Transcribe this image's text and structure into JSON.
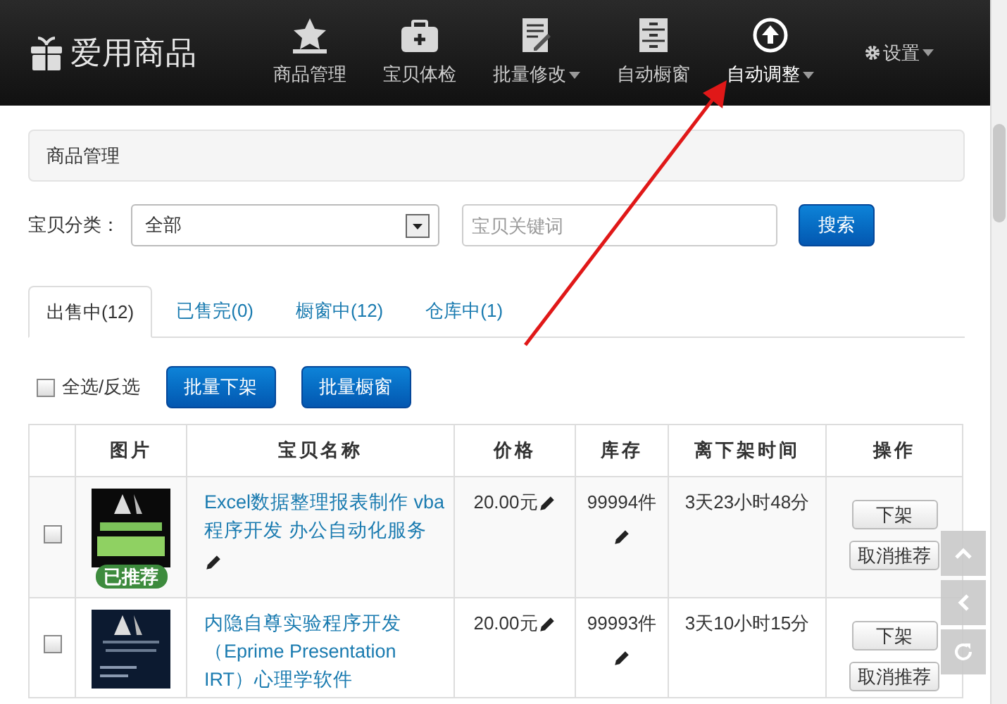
{
  "brand": "爱用商品",
  "nav": [
    {
      "label": "商品管理",
      "kind": "star",
      "dropdown": false,
      "selected": false
    },
    {
      "label": "宝贝体检",
      "kind": "kit",
      "dropdown": false,
      "selected": false
    },
    {
      "label": "批量修改",
      "kind": "edit",
      "dropdown": true,
      "selected": false
    },
    {
      "label": "自动橱窗",
      "kind": "cabinet",
      "dropdown": false,
      "selected": false
    },
    {
      "label": "自动调整",
      "kind": "up",
      "dropdown": true,
      "selected": true
    }
  ],
  "settings": "设置",
  "breadcrumb": "商品管理",
  "filter": {
    "label": "宝贝分类：",
    "category": "全部",
    "keyword_placeholder": "宝贝关键词",
    "search_button": "搜索"
  },
  "tabs": [
    {
      "label": "出售中(12)",
      "selected": true
    },
    {
      "label": "已售完(0)",
      "selected": false
    },
    {
      "label": "橱窗中(12)",
      "selected": false
    },
    {
      "label": "仓库中(1)",
      "selected": false
    }
  ],
  "bulk": {
    "select_all": "全选/反选",
    "checked": false,
    "buttons": [
      "批量下架",
      "批量橱窗"
    ]
  },
  "table": {
    "columns": [
      "图片",
      "宝贝名称",
      "价格",
      "库存",
      "离下架时间",
      "操作"
    ],
    "rows": [
      {
        "checked": false,
        "badge": "已推荐",
        "name": "Excel数据整理报表制作 vba程序开发 办公自动化服务",
        "price": "20.00元",
        "stock": "99994件",
        "time": "3天23小时48分",
        "actions": [
          "下架",
          "取消推荐"
        ]
      },
      {
        "checked": false,
        "name": "内隐自尊实验程序开发（Eprime Presentation IRT）心理学软件",
        "price": "20.00元",
        "stock": "99993件",
        "time": "3天10小时15分",
        "actions": [
          "下架",
          "取消推荐"
        ]
      }
    ]
  }
}
